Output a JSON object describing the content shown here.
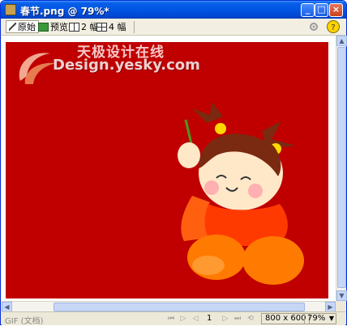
{
  "window": {
    "title": "春节.png @ 79%*",
    "minimize_label": "_",
    "maximize_label": "□",
    "close_label": "×"
  },
  "toolbar": {
    "original_label": "原始",
    "preview_label": "预览",
    "two_up_label": "2 幅",
    "four_up_label": "4 幅",
    "right_icon_1": "gear-icon",
    "right_icon_2": "help-icon"
  },
  "canvas": {
    "background_color": "#c00000",
    "watermark_cn": "天极设计在线",
    "watermark_en": "Design.yesky.com"
  },
  "statusbar": {
    "format": "GIF (文档)",
    "frame": "1",
    "dimensions": "800 x 600",
    "zoom": "79%",
    "controls": [
      "first-frame-icon",
      "play-icon",
      "next-frame-icon",
      "last-frame-icon",
      "loop-icon"
    ]
  },
  "colors": {
    "titlebar": "#0055e5",
    "chrome": "#ece9d8",
    "canvas_red": "#c00000"
  }
}
